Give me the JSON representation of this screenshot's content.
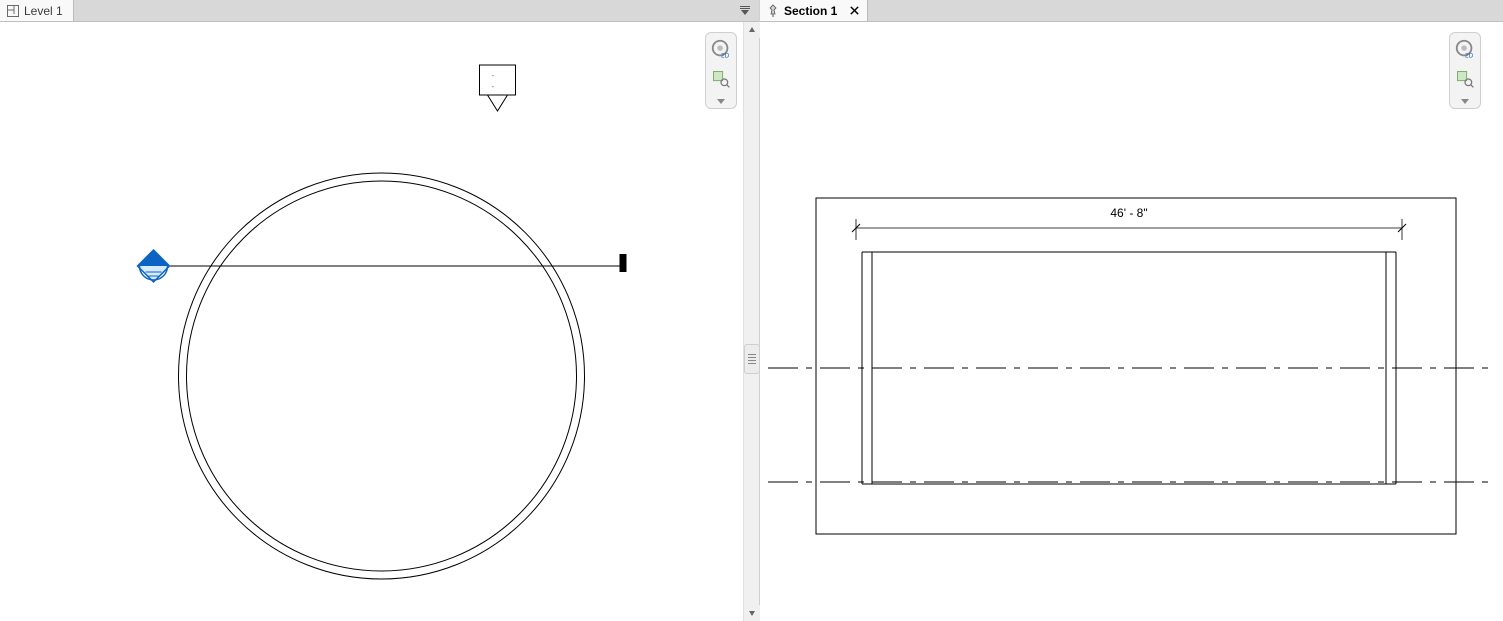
{
  "panes": {
    "left": {
      "tab": {
        "label": "Level 1",
        "icon": "floorplan-icon"
      },
      "nav": {
        "mode": "2D"
      }
    },
    "right": {
      "tab": {
        "label": "Section 1",
        "icon": "pin-icon",
        "hasClose": true
      },
      "nav": {
        "mode": "2D"
      },
      "dimension": "46' - 8\""
    }
  },
  "colors": {
    "section_marker": "#0b64c4",
    "line": "#000000",
    "widget_2d_text": "#1463b0"
  }
}
